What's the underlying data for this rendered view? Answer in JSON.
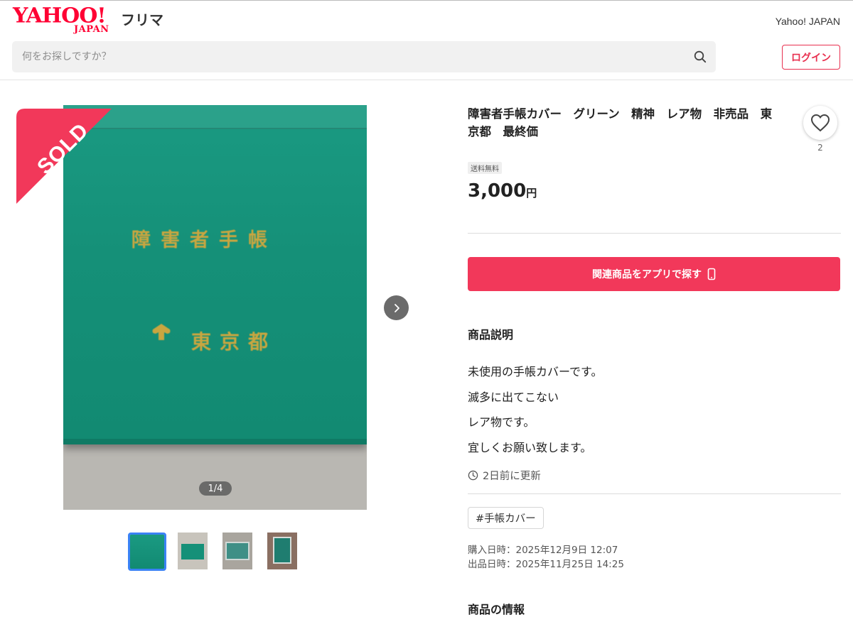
{
  "header": {
    "logo_yahoo": "YAHOO!",
    "logo_japan": "JAPAN",
    "logo_service": "フリマ",
    "yahoo_japan_link": "Yahoo! JAPAN",
    "search_placeholder": "何をお探しですか？",
    "login_label": "ログイン"
  },
  "gallery": {
    "sold_label": "SOLD",
    "cover_text": "障害者手帳",
    "cover_city": "東京都",
    "counter": "1/4",
    "thumbnails": 4
  },
  "item": {
    "title": "障害者手帳カバー　グリーン　精神　レア物　非売品　東京都　最終価",
    "favorite_count": "2",
    "shipping_badge": "送料無料",
    "price": "3,000",
    "price_unit": "円",
    "app_button_label": "関連商品をアプリで探す",
    "description_heading": "商品説明",
    "description_lines": [
      "未使用の手帳カバーです。",
      "滅多に出てこない",
      "レア物です。",
      "宜しくお願い致します。"
    ],
    "updated": "2日前に更新",
    "tag": "#手帳カバー",
    "purchase_date": "購入日時：2025年12月9日 12:07",
    "listing_date": "出品日時：2025年11月25日 14:25",
    "next_heading": "商品の情報"
  },
  "colors": {
    "brand_red": "#ff0033",
    "accent_pink": "#f2385a",
    "cover_green": "#159078"
  }
}
